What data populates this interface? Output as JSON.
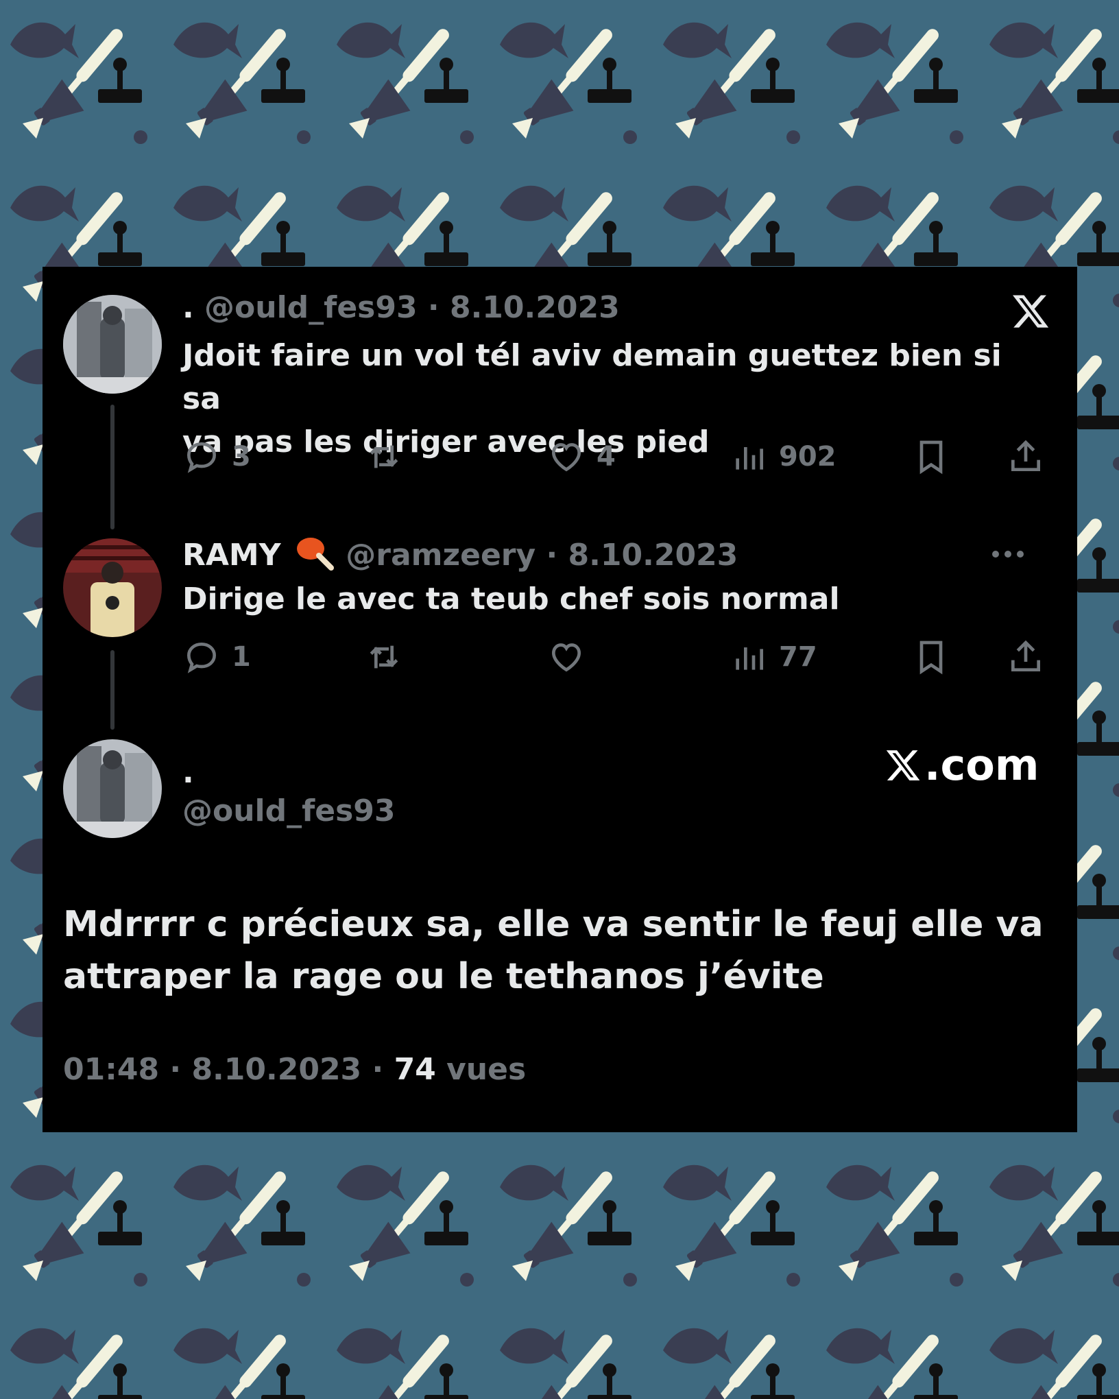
{
  "colors": {
    "background": "#3f6a80",
    "pattern_dark": "#3a3e52",
    "pattern_light": "#f2f2df",
    "card": "#000000",
    "text_primary": "#e7e9ea",
    "text_secondary": "#71767b"
  },
  "tweet1": {
    "name": ".",
    "handle": "@ould_fes93",
    "date": "8.10.2023",
    "text_line1": "Jdoit faire un vol tél aviv demain guettez bien si sa",
    "text_line2": "va pas les diriger avec les pied",
    "replies": "3",
    "likes": "4",
    "views": "902"
  },
  "tweet2": {
    "name": "RAMY",
    "name_emoji": "chicken-leg-icon",
    "handle": "@ramzeery",
    "date": "8.10.2023",
    "text": "Dirige le avec ta teub chef sois normal",
    "replies": "1",
    "views": "77"
  },
  "tweet3": {
    "name": ".",
    "handle": "@ould_fes93",
    "text_line1": "Mdrrrr c précieux sa, elle va sentir le feuj elle va",
    "text_line2": "attraper la rage ou le tethanos j’évite",
    "time": "01:48",
    "date": "8.10.2023",
    "views_num": "74",
    "views_label": "vues"
  },
  "brand": {
    "watermark": ".com",
    "logo": "x-logo-icon"
  },
  "separator": "·"
}
